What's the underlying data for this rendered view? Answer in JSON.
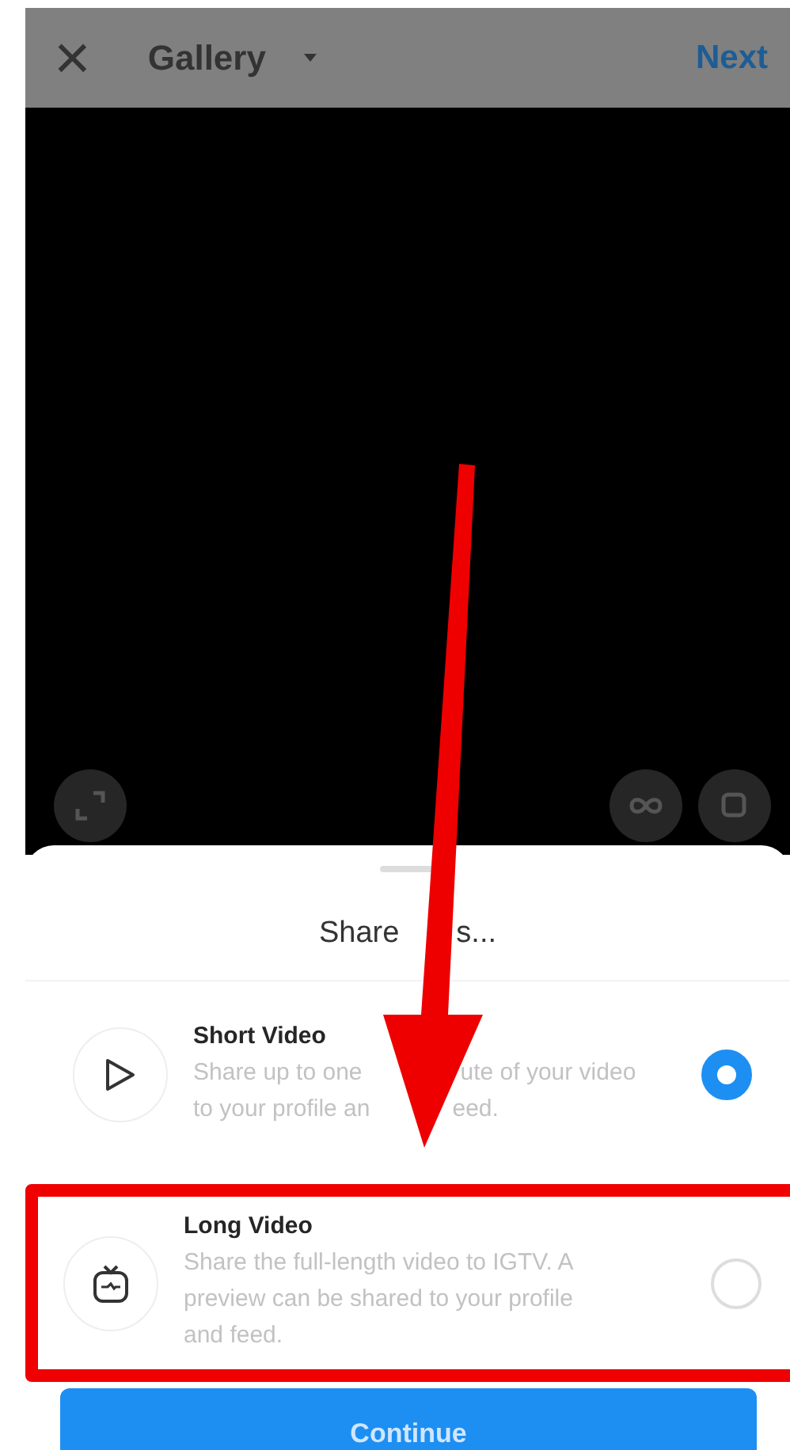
{
  "header": {
    "close_icon": "×",
    "title": "Gallery",
    "next": "Next"
  },
  "sheet": {
    "title_parts": [
      "Share",
      "s..."
    ],
    "options": [
      {
        "kind": "play",
        "title": "Short Video",
        "description_lines": [
          [
            "Share up to one",
            "ute of your video"
          ],
          [
            "to your profile an",
            "eed."
          ]
        ],
        "selected": true,
        "highlighted": false
      },
      {
        "kind": "tv",
        "title": "Long Video",
        "description_lines": [
          [
            "Share the full-length video to IGTV. A"
          ],
          [
            "preview can be shared to your profile"
          ],
          [
            "and feed."
          ]
        ],
        "selected": false,
        "highlighted": true
      }
    ],
    "button": "Continue"
  },
  "annotation_arrow": true
}
